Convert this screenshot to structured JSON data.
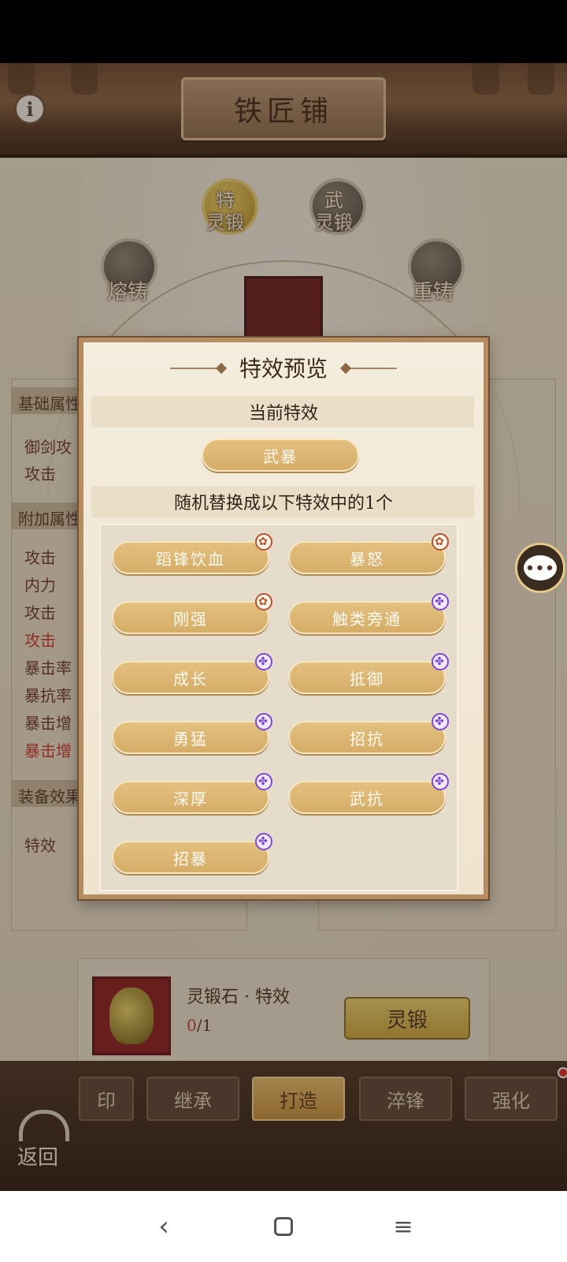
{
  "header": {
    "title": "铁匠铺",
    "info_icon": "info-icon"
  },
  "skills": {
    "tejin": "特\n灵锻",
    "wuduan": "武\n灵锻",
    "rongzhu": "熔铸",
    "chongzhu": "重铸"
  },
  "left_panel": {
    "base_header": "基础属性",
    "attr1": "御剑攻",
    "attr2": "攻击",
    "extra_header": "附加属性",
    "extra": [
      "攻击",
      "内力",
      "攻击",
      "攻击",
      "暴击率",
      "暴抗率",
      "暴击增",
      "暴击增"
    ],
    "equip_header": "装备效果",
    "equip_label": "特效"
  },
  "material": {
    "name": "灵锻石 · 特效",
    "have": "0",
    "need": "/1",
    "button": "灵锻"
  },
  "tabs": [
    "印",
    "继承",
    "打造",
    "淬锋",
    "强化"
  ],
  "back_label": "返回",
  "modal": {
    "title": "特效预览",
    "current_label": "当前特效",
    "current_effect": "武暴",
    "random_label": "随机替换成以下特效中的1个",
    "options": [
      {
        "label": "蹈锋饮血",
        "badge": "orange"
      },
      {
        "label": "暴怒",
        "badge": "orange"
      },
      {
        "label": "刚强",
        "badge": "orange"
      },
      {
        "label": "触类旁通",
        "badge": "purple"
      },
      {
        "label": "成长",
        "badge": "purple"
      },
      {
        "label": "抵御",
        "badge": "purple"
      },
      {
        "label": "勇猛",
        "badge": "purple"
      },
      {
        "label": "招抗",
        "badge": "purple"
      },
      {
        "label": "深厚",
        "badge": "purple"
      },
      {
        "label": "武抗",
        "badge": "purple"
      },
      {
        "label": "招暴",
        "badge": "purple"
      }
    ]
  },
  "nav": {
    "back": "‹",
    "home": "",
    "menu": "≡"
  },
  "colors": {
    "pill": "#d9b26c",
    "accent_red": "#c83a2d",
    "frame": "#b58d63"
  }
}
